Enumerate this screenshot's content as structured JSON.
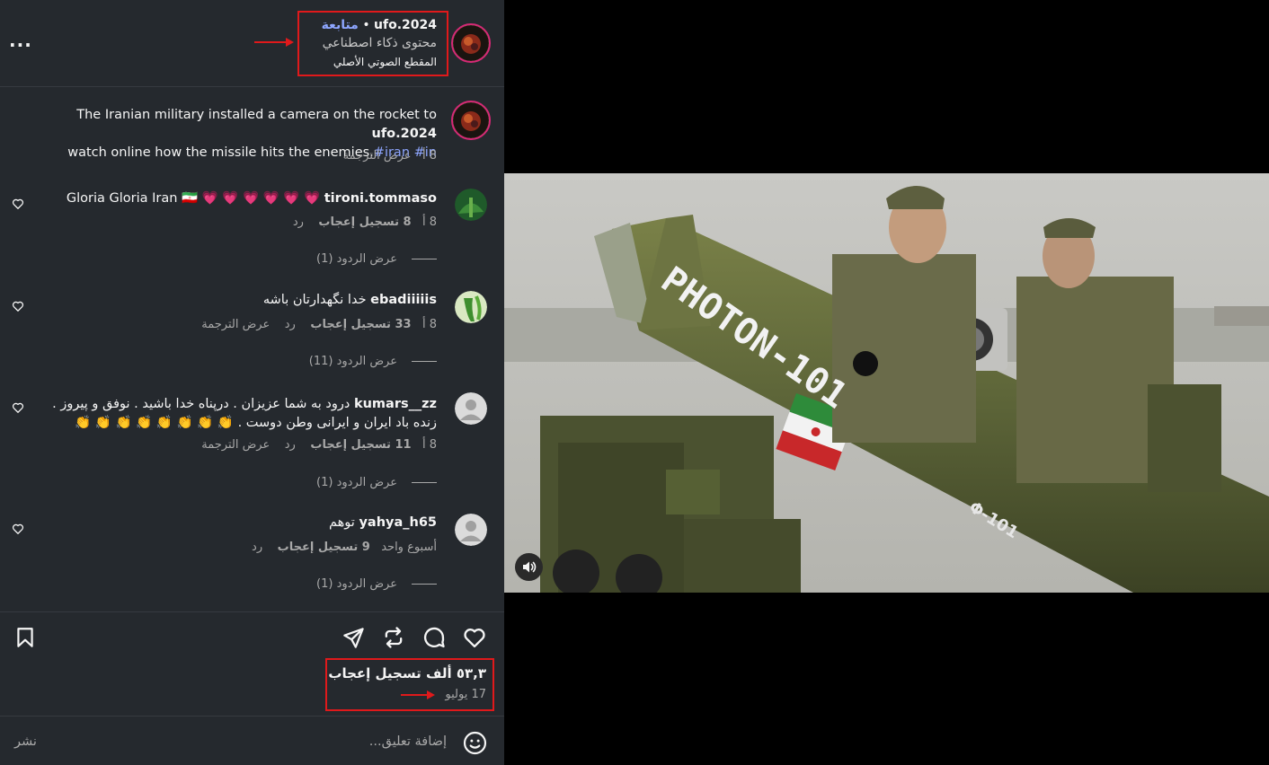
{
  "header": {
    "username": "ufo.2024",
    "separator": "•",
    "follow": "متابعة",
    "subtitle": "محتوى ذكاء اصطناعي",
    "audio": "المقطع الصوتي الأصلي",
    "more": "..."
  },
  "caption": {
    "username": "ufo.2024",
    "text_before": "The Iranian military installed a camera on the rocket to",
    "text_after": "watch online how the missile hits the enemies.",
    "hashtags": "#iran #in",
    "time": "8 أ",
    "translate": "عرض الترجمة"
  },
  "comments": [
    {
      "username": "tironi.tommaso",
      "text": "Gloria Gloria Iran 🇮🇷 💗 💗 💗 💗 💗 💗",
      "time": "8 أ",
      "likes": "8 تسجيل إعجاب",
      "reply": "رد",
      "translate": "",
      "view_replies": "عرض الردود (1)"
    },
    {
      "username": "ebadiiiiis",
      "text": "خدا نگهدارتان باشه",
      "time": "8 أ",
      "likes": "33 تسجيل إعجاب",
      "reply": "رد",
      "translate": "عرض الترجمة",
      "view_replies": "عرض الردود (11)"
    },
    {
      "username": "kumars__zz",
      "text_line1": "درود به شما عزیزان . درپناه خدا باشید  . نوفق و پیروز .",
      "text_line2": "زنده باد ایران و ایرانی وطن دوست . 👏 👏 👏 👏 👏 👏 👏 👏",
      "time": "8 أ",
      "likes": "11 تسجيل إعجاب",
      "reply": "رد",
      "translate": "عرض الترجمة",
      "view_replies": "عرض الردود (1)"
    },
    {
      "username": "yahya_h65",
      "text": "توهم",
      "time": "أسبوع واحد",
      "likes": "9 تسجيل إعجاب",
      "reply": "رد",
      "translate": "",
      "view_replies": "عرض الردود (1)"
    }
  ],
  "actions": {
    "likes_count": "٥٣,٣ ألف تسجيل إعجاب",
    "date": "17 يوليو"
  },
  "composer": {
    "placeholder": "إضافة تعليق...",
    "post": "نشر"
  },
  "video": {
    "rocket_text": "PHOTON-101",
    "rocket_code": "Φ-101"
  },
  "colors": {
    "panel_bg": "#25292e",
    "accent_link": "#8ea6ff",
    "annotation_red": "#e0191b",
    "rocket_green": "#5c6438"
  },
  "icons": [
    "more-icon",
    "heart-icon",
    "comment-icon",
    "repost-icon",
    "share-icon",
    "bookmark-icon",
    "emoji-icon",
    "volume-icon"
  ]
}
